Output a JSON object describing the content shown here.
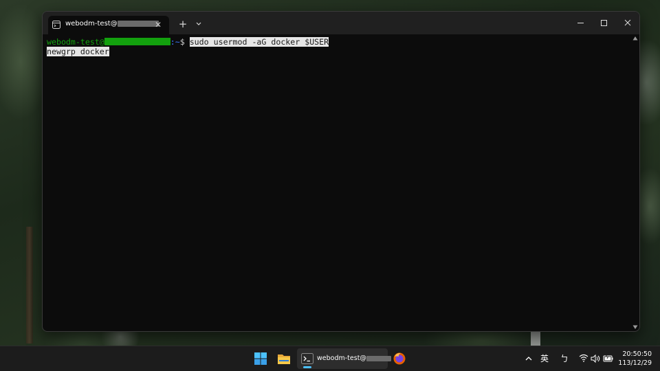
{
  "window": {
    "tab_title": "webodm-test@",
    "tab_close": "✕",
    "new_tab": "+"
  },
  "terminal": {
    "prompt_user": "webodm-test@",
    "prompt_path": ":~",
    "prompt_symbol": "$ ",
    "command_line1": "sudo usermod -aG docker $USER",
    "command_line2": "newgrp docker"
  },
  "taskbar": {
    "terminal_label": "webodm-test@",
    "ime_label": "英",
    "ime_mode": "ㄅ"
  },
  "clock": {
    "time": "20:50:50",
    "date": "113/12/29"
  },
  "colors": {
    "terminal_bg": "#0c0c0c",
    "prompt_green": "#13a10e",
    "prompt_blue": "#3b78ff",
    "taskbar_bg": "#1c1c1c",
    "accent": "#4cc2ff"
  },
  "icons": {
    "tab_icon": "terminal-tab-icon",
    "start": "windows-start-icon",
    "explorer": "file-explorer-icon",
    "firefox": "firefox-icon",
    "wifi": "wifi-icon",
    "volume": "volume-icon",
    "battery": "battery-icon"
  }
}
